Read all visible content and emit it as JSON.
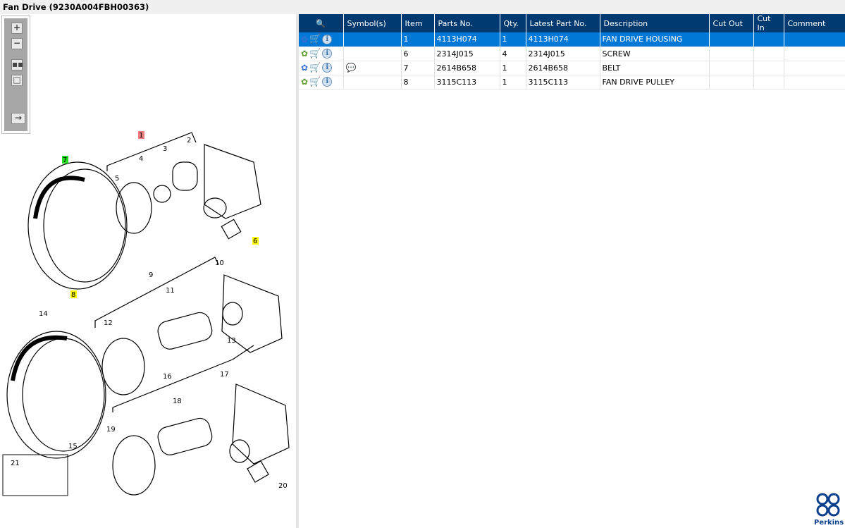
{
  "title": "Fan Drive (9230A004FBH00363)",
  "toolbar": {
    "zoom_in": "+",
    "zoom_out": "−"
  },
  "table": {
    "headers": [
      "",
      "Symbol(s)",
      "Item",
      "Parts No.",
      "Qty.",
      "Latest Part No.",
      "Description",
      "Cut Out",
      "Cut In",
      "Comment"
    ],
    "rows": [
      {
        "selected": true,
        "gear": "blue-green",
        "symbol": "",
        "item": "1",
        "part": "4113H074",
        "qty": "1",
        "latest": "4113H074",
        "desc": "FAN DRIVE HOUSING",
        "cut_out": "",
        "cut_in": "",
        "comment": ""
      },
      {
        "selected": false,
        "gear": "green",
        "symbol": "",
        "item": "6",
        "part": "2314J015",
        "qty": "4",
        "latest": "2314J015",
        "desc": "SCREW",
        "cut_out": "",
        "cut_in": "",
        "comment": ""
      },
      {
        "selected": false,
        "gear": "blue-green",
        "symbol": "comment-alert-icon",
        "item": "7",
        "part": "2614B658",
        "qty": "1",
        "latest": "2614B658",
        "desc": "BELT",
        "cut_out": "",
        "cut_in": "",
        "comment": ""
      },
      {
        "selected": false,
        "gear": "green",
        "symbol": "",
        "item": "8",
        "part": "3115C113",
        "qty": "1",
        "latest": "3115C113",
        "desc": "FAN DRIVE PULLEY",
        "cut_out": "",
        "cut_in": "",
        "comment": ""
      }
    ]
  },
  "callouts": [
    "1",
    "2",
    "3",
    "4",
    "5",
    "6",
    "7",
    "8",
    "9",
    "10",
    "11",
    "12",
    "13",
    "14",
    "15",
    "16",
    "17",
    "18",
    "19",
    "20",
    "21"
  ],
  "highlight_colors": {
    "red": "#f08080",
    "green": "#22dd22",
    "yellow": "#ffff00"
  },
  "logo": "Perkins"
}
